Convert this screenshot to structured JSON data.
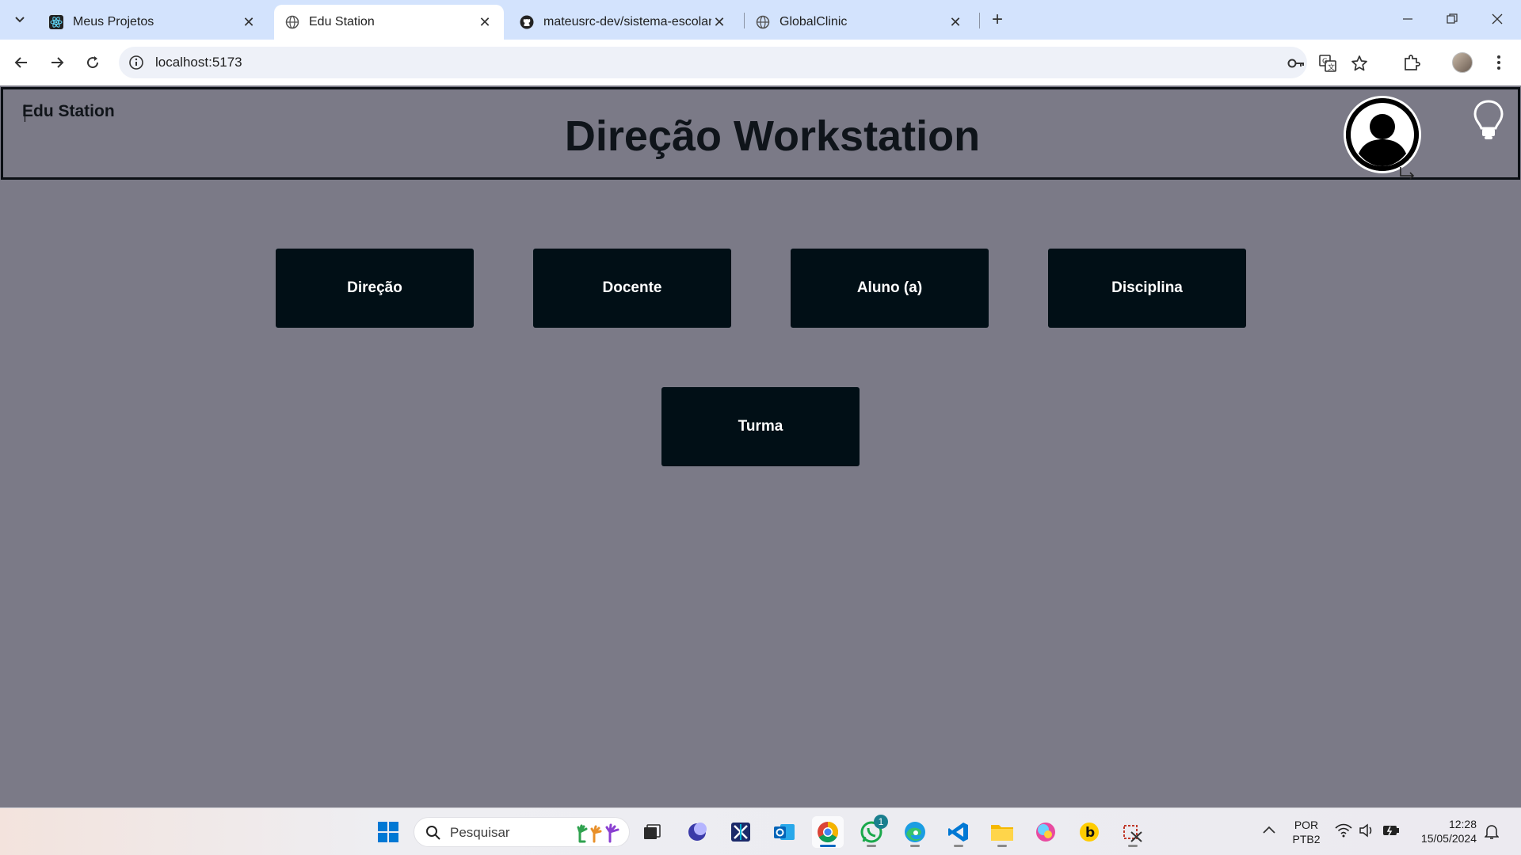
{
  "browser": {
    "tabs": [
      {
        "title": "Meus Projetos",
        "active": false
      },
      {
        "title": "Edu Station",
        "active": true
      },
      {
        "title": "mateusrc-dev/sistema-escolar-f",
        "active": false
      },
      {
        "title": "GlobalClinic",
        "active": false
      }
    ],
    "url": "localhost:5173"
  },
  "app": {
    "brand": "Edu Station",
    "title": "Direção Workstation",
    "cards": [
      {
        "label": "Direção"
      },
      {
        "label": "Docente"
      },
      {
        "label": "Aluno (a)"
      },
      {
        "label": "Disciplina"
      },
      {
        "label": "Turma"
      }
    ]
  },
  "taskbar": {
    "search_placeholder": "Pesquisar",
    "whatsapp_badge": "1",
    "lang_top": "POR",
    "lang_bottom": "PTB2",
    "time": "12:28",
    "date": "15/05/2024"
  },
  "colors": {
    "page_bg": "#7b7a87",
    "card_bg": "#010f16",
    "tabstrip_bg": "#d3e3fd"
  }
}
